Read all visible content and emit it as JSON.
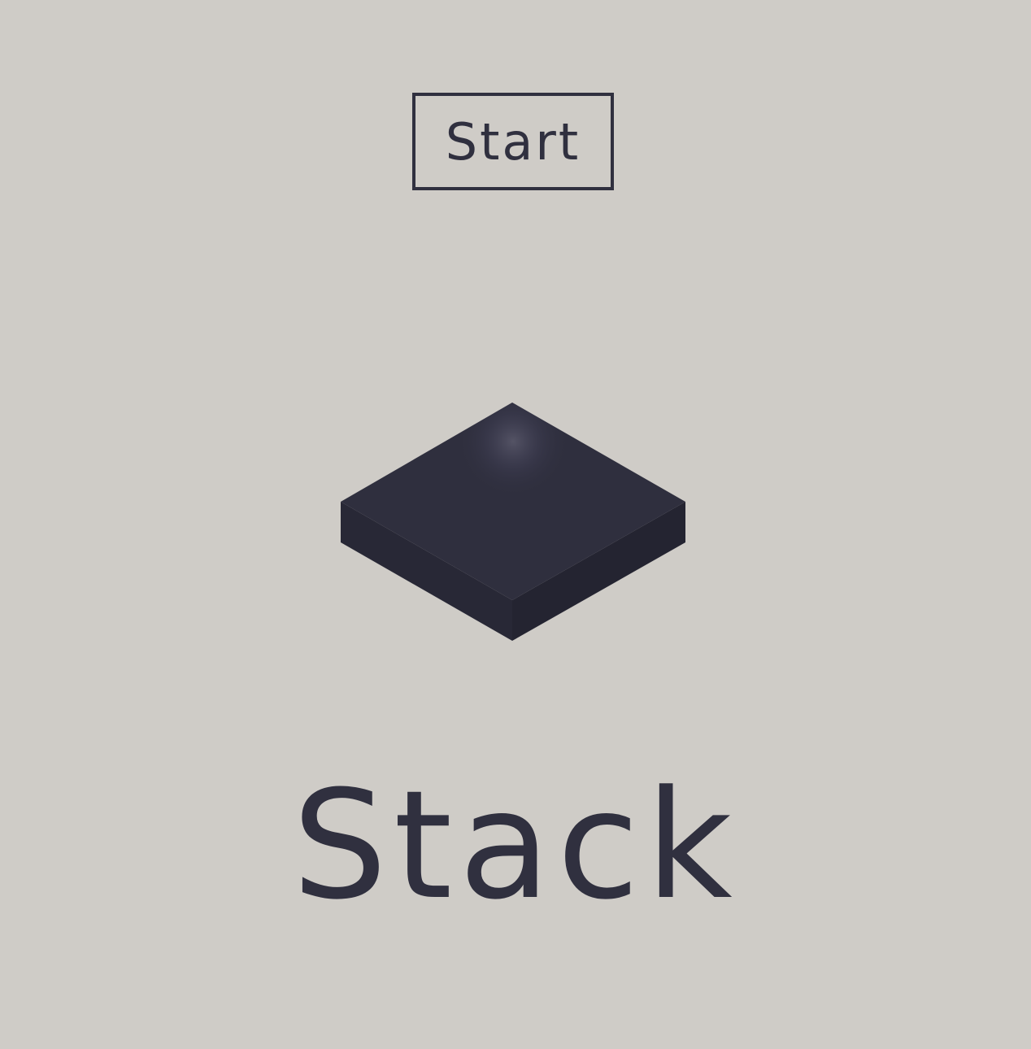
{
  "app": {
    "start_label": "Start",
    "title": "Stack"
  },
  "colors": {
    "background": "#cfccc7",
    "ink": "#30303f",
    "block_top": "#2f2f3e",
    "block_left": "#282836",
    "block_right": "#242431"
  },
  "icons": {
    "block": "isometric-block-icon"
  }
}
